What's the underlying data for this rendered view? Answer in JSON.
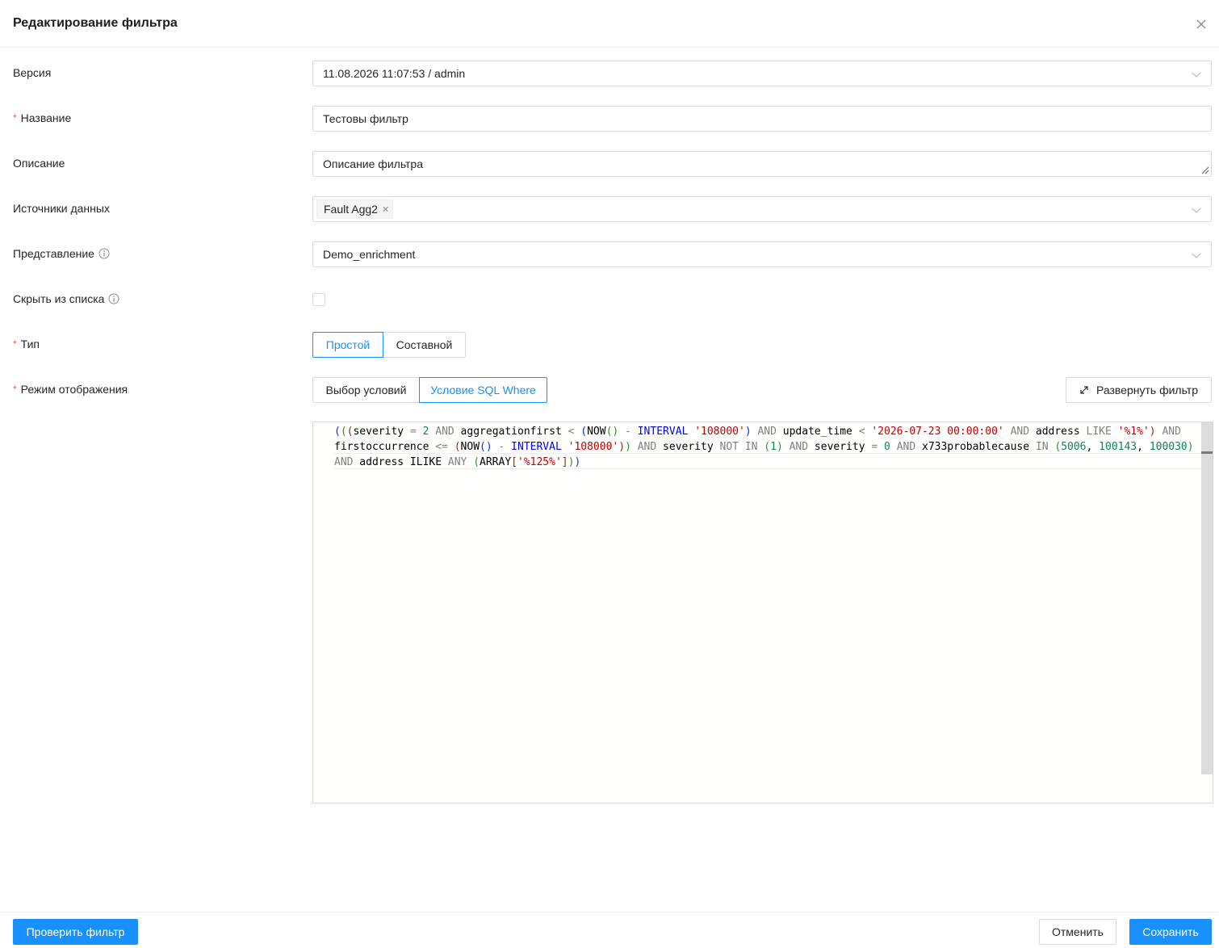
{
  "dialog": {
    "title": "Редактирование фильтра"
  },
  "form": {
    "version": {
      "label": "Версия",
      "value": "11.08.2026 11:07:53 / admin"
    },
    "name": {
      "label": "Название",
      "required": "*",
      "value": "Тестовы фильтр"
    },
    "description": {
      "label": "Описание",
      "value": "Описание фильтра"
    },
    "sources": {
      "label": "Источники данных",
      "tags": [
        "Fault Agg2"
      ]
    },
    "view": {
      "label": "Представление",
      "value": "Demo_enrichment"
    },
    "hide": {
      "label": "Скрыть из списка",
      "checked": false
    },
    "type": {
      "label": "Тип",
      "required": "*",
      "options": [
        "Простой",
        "Составной"
      ],
      "selected": "Простой"
    },
    "mode": {
      "label": "Режим отображения",
      "required": "*",
      "options": [
        "Выбор условий",
        "Условие SQL Where"
      ],
      "selected": "Условие SQL Where"
    },
    "expand_label": "Развернуть фильтр"
  },
  "sql": {
    "lines": [
      "(((severity = 2 AND aggregationfirst < (NOW() - INTERVAL '108000') AND update_time < '2026-07-23 00:00:00' AND address LIKE '%1%') AND",
      "firstoccurrence <= (NOW() - INTERVAL '108000')) AND severity NOT IN (1) AND severity = 0 AND x733probablecause IN (5006, 100143, 100030)",
      "AND address ILIKE ANY (ARRAY['%125%']))"
    ]
  },
  "footer": {
    "check_label": "Проверить фильтр",
    "cancel_label": "Отменить",
    "save_label": "Сохранить"
  },
  "colors": {
    "primary": "#1890ff",
    "required": "#ff4d4f",
    "border": "#d9d9d9"
  }
}
